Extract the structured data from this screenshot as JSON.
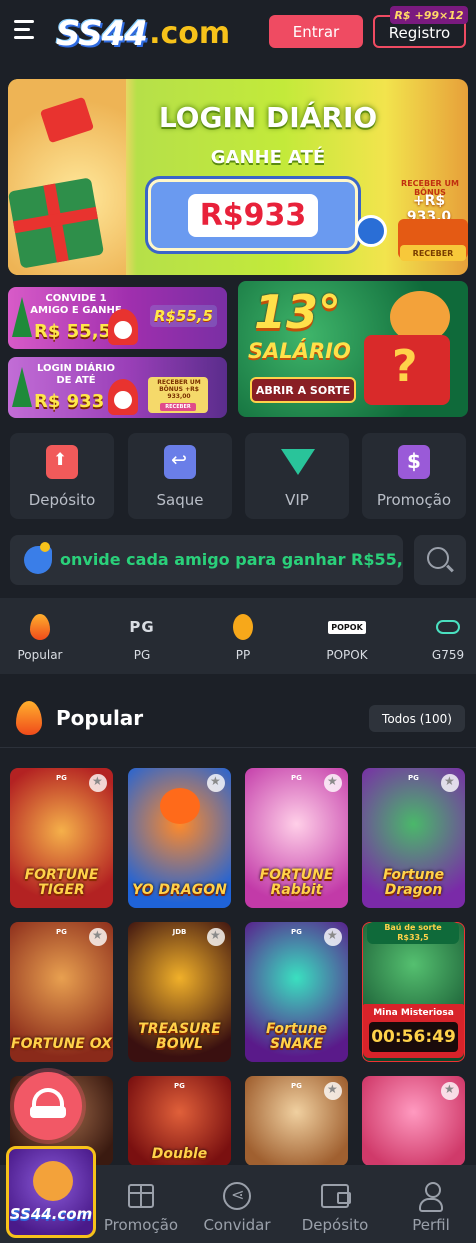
{
  "header": {
    "logo_ss": "SS44",
    "logo_com": ".com",
    "login_label": "Entrar",
    "register_label": "Registro",
    "register_badge_currency": "R$",
    "register_badge_bonus": "+99×12"
  },
  "banner_main": {
    "title": "LOGIN DIÁRIO",
    "subtitle": "GANHE ATÉ",
    "amount": "R$933",
    "side_caption": "RECEBER UM BÔNUS",
    "side_amount": "+R$ 933,0",
    "side_button": "RECEBER"
  },
  "banner_invite": {
    "text": "CONVIDE 1 AMIGO E GANHE",
    "amount": "R$ 55,5",
    "tag": "R$55,5"
  },
  "banner_login": {
    "text": "LOGIN DIÁRIO DE ATÉ",
    "amount": "R$ 933",
    "box_text": "RECEBER UM BÔNUS +R$ 933,00",
    "box_button": "RECEBER"
  },
  "banner_salary": {
    "number": "13°",
    "word": "SALÁRIO",
    "button": "ABRIR A SORTE"
  },
  "quick_actions": [
    {
      "label": "Depósito",
      "icon": "deposit-icon"
    },
    {
      "label": "Saque",
      "icon": "withdraw-icon"
    },
    {
      "label": "VIP",
      "icon": "vip-diamond-icon"
    },
    {
      "label": "Promoção",
      "icon": "promotion-icon"
    }
  ],
  "marquee": {
    "text": "onvide cada amigo para ganhar R$55,5"
  },
  "categories": [
    {
      "label": "Popular",
      "icon": "fire-icon"
    },
    {
      "label": "PG",
      "icon_text": "PG"
    },
    {
      "label": "PP",
      "icon": "pp-icon"
    },
    {
      "label": "POPOK",
      "icon_text": "POPOK"
    },
    {
      "label": "G759",
      "icon": "g759-icon"
    }
  ],
  "popular": {
    "title": "Popular",
    "all_button": "Todos (100)"
  },
  "games": [
    {
      "name": "FORTUNE TIGER",
      "provider": "PG"
    },
    {
      "name": "YO DRAGON",
      "provider": ""
    },
    {
      "name": "FORTUNE Rabbit",
      "provider": "PG"
    },
    {
      "name": "Fortune Dragon",
      "provider": "PG"
    },
    {
      "name": "FORTUNE OX",
      "provider": "PG"
    },
    {
      "name": "TREASURE BOWL",
      "provider": "JDB"
    },
    {
      "name": "Fortune SNAKE",
      "provider": "PG"
    },
    {
      "name": "",
      "provider": ""
    },
    {
      "name": "",
      "provider": "PG"
    },
    {
      "name": "Double",
      "provider": "PG"
    },
    {
      "name": "",
      "provider": "PG"
    },
    {
      "name": "",
      "provider": ""
    }
  ],
  "mystery": {
    "chest_label": "Baú de sorte",
    "chest_amount": "R$33,5",
    "title": "Mina Misteriosa",
    "timer": "00:56:49"
  },
  "bottom_nav": {
    "logo": "SS44.com",
    "items": [
      {
        "label": "Promoção",
        "icon": "gift-icon"
      },
      {
        "label": "Convidar",
        "icon": "share-icon"
      },
      {
        "label": "Depósito",
        "icon": "wallet-icon"
      },
      {
        "label": "Perfil",
        "icon": "user-icon"
      }
    ]
  },
  "colors": {
    "background": "#1c2027",
    "accent": "#ef4b62",
    "brand_yellow": "#f7c21a",
    "marquee_green": "#2ad07a"
  }
}
